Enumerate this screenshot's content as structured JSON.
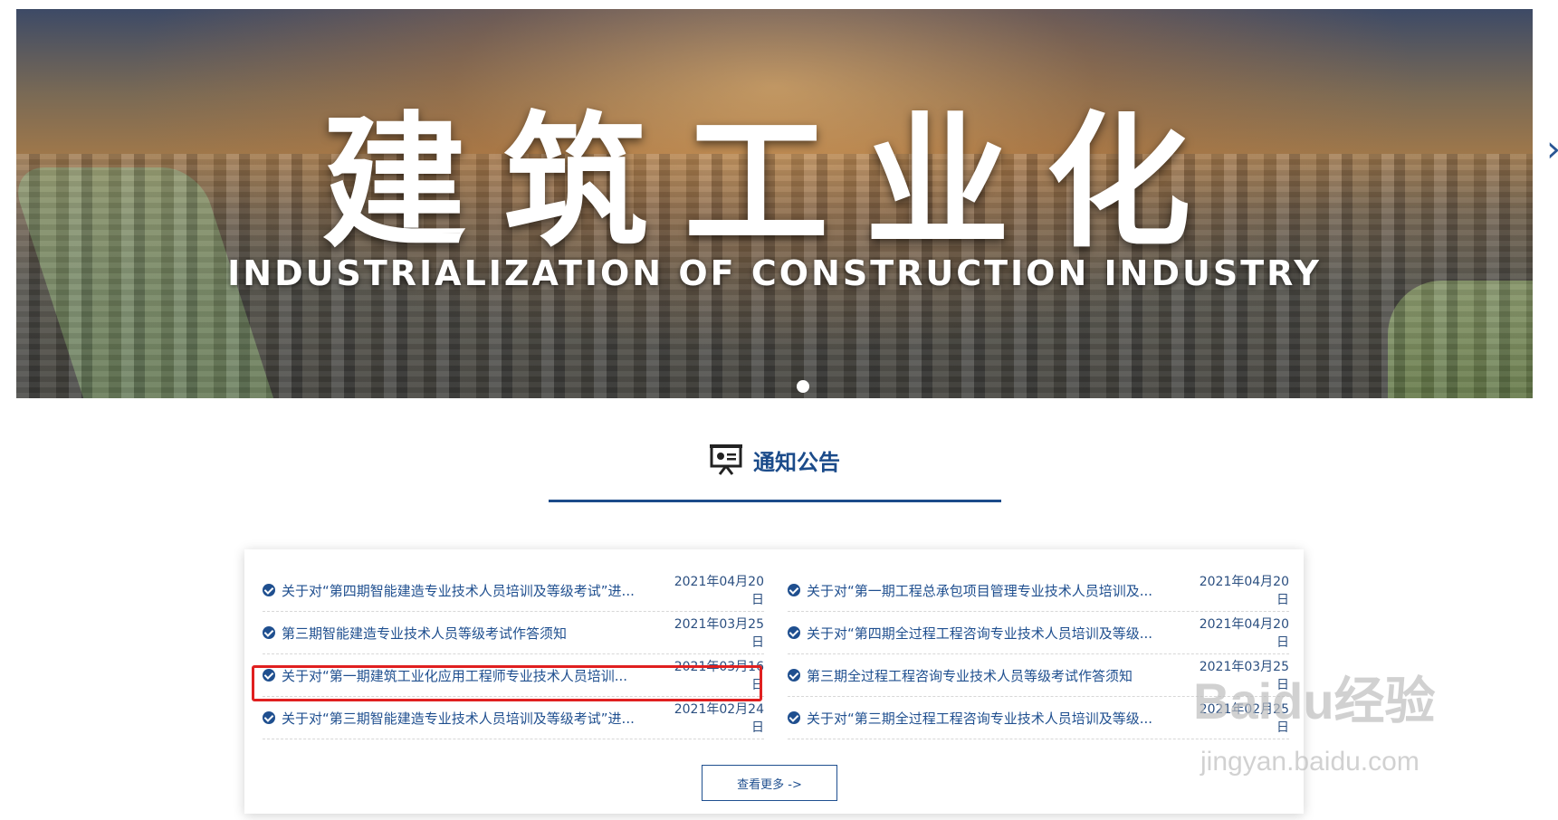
{
  "banner": {
    "title_cn": "建筑工业化",
    "title_en": "INDUSTRIALIZATION OF CONSTRUCTION INDUSTRY"
  },
  "section": {
    "title": "通知公告",
    "icon": "presentation-board-icon"
  },
  "notices": {
    "left": [
      {
        "text": "关于对“第四期智能建造专业技术人员培训及等级考试”进...",
        "date": "2021年04月20日"
      },
      {
        "text": "第三期智能建造专业技术人员等级考试作答须知",
        "date": "2021年03月25日"
      },
      {
        "text": "关于对“第一期建筑工业化应用工程师专业技术人员培训...",
        "date": "2021年03月16日"
      },
      {
        "text": "关于对“第三期智能建造专业技术人员培训及等级考试”进...",
        "date": "2021年02月24日"
      }
    ],
    "right": [
      {
        "text": "关于对“第一期工程总承包项目管理专业技术人员培训及...",
        "date": "2021年04月20日"
      },
      {
        "text": "关于对“第四期全过程工程咨询专业技术人员培训及等级...",
        "date": "2021年04月20日"
      },
      {
        "text": "第三期全过程工程咨询专业技术人员等级考试作答须知",
        "date": "2021年03月25日"
      },
      {
        "text": "关于对“第三期全过程工程咨询专业技术人员培训及等级...",
        "date": "2021年02月25日"
      }
    ]
  },
  "more_button": "查看更多 ->",
  "watermark": {
    "logo": "Baidu经验",
    "sub": "jingyan.baidu.com"
  },
  "colors": {
    "accent": "#1b4b8a",
    "highlight": "#e02020"
  }
}
